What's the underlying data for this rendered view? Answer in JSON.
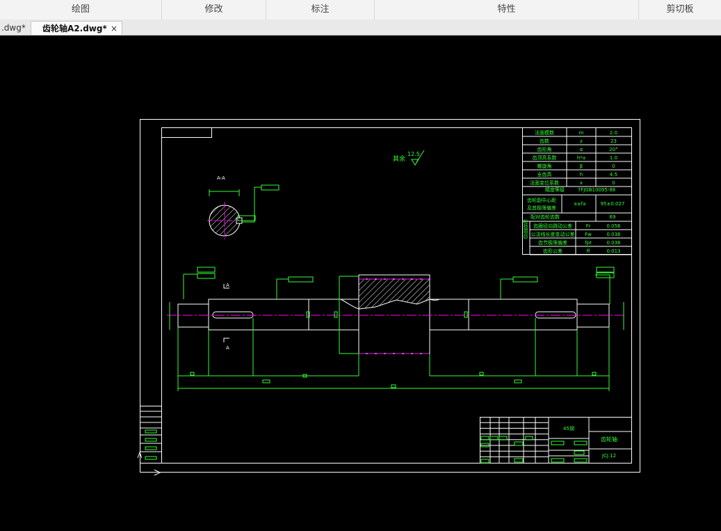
{
  "ribbon": {
    "draw": "绘图",
    "modify": "修改",
    "annotate": "标注",
    "properties": "特性",
    "clipboard": "剪切板"
  },
  "tabs": [
    {
      "label": ".dwg*"
    },
    {
      "label": "齿轮轴A2.dwg*",
      "close": "×"
    }
  ],
  "drawing": {
    "section_label": "A-A",
    "view_mark": "A",
    "roughness_note": "其余",
    "roughness_value": "12.5",
    "params": [
      [
        "法面模数",
        "m",
        "2.0"
      ],
      [
        "齿数",
        "z",
        "23"
      ],
      [
        "齿形角",
        "α",
        "20°"
      ],
      [
        "齿顶高系数",
        "h*a",
        "1.0"
      ],
      [
        "螺旋角",
        "β",
        "0"
      ],
      [
        "全齿高",
        "h",
        "4.5"
      ],
      [
        "法面变位系数",
        "x",
        "0"
      ]
    ],
    "precision_label": "精度等级",
    "precision_value": "7FJGB10095-88",
    "center_label_1": "齿轮副中心距",
    "center_label_2": "及其极限偏差",
    "center_symbol": "a±fa",
    "center_value": "95±0.027",
    "mating_label": "配对齿轮齿数",
    "mating_value": "69",
    "check_group": "检验项目",
    "checks": [
      [
        "齿圈径向跳动公差",
        "Fr",
        "0.056"
      ],
      [
        "公法线长度变动公差",
        "Fw",
        "0.036"
      ],
      [
        "齿节极限偏差",
        "fpt",
        "0.036"
      ],
      [
        "齿形公差",
        "ff",
        "0.013"
      ]
    ],
    "material": "45钢",
    "part_name": "齿轮轴",
    "drawing_no": "JCJ.12"
  }
}
